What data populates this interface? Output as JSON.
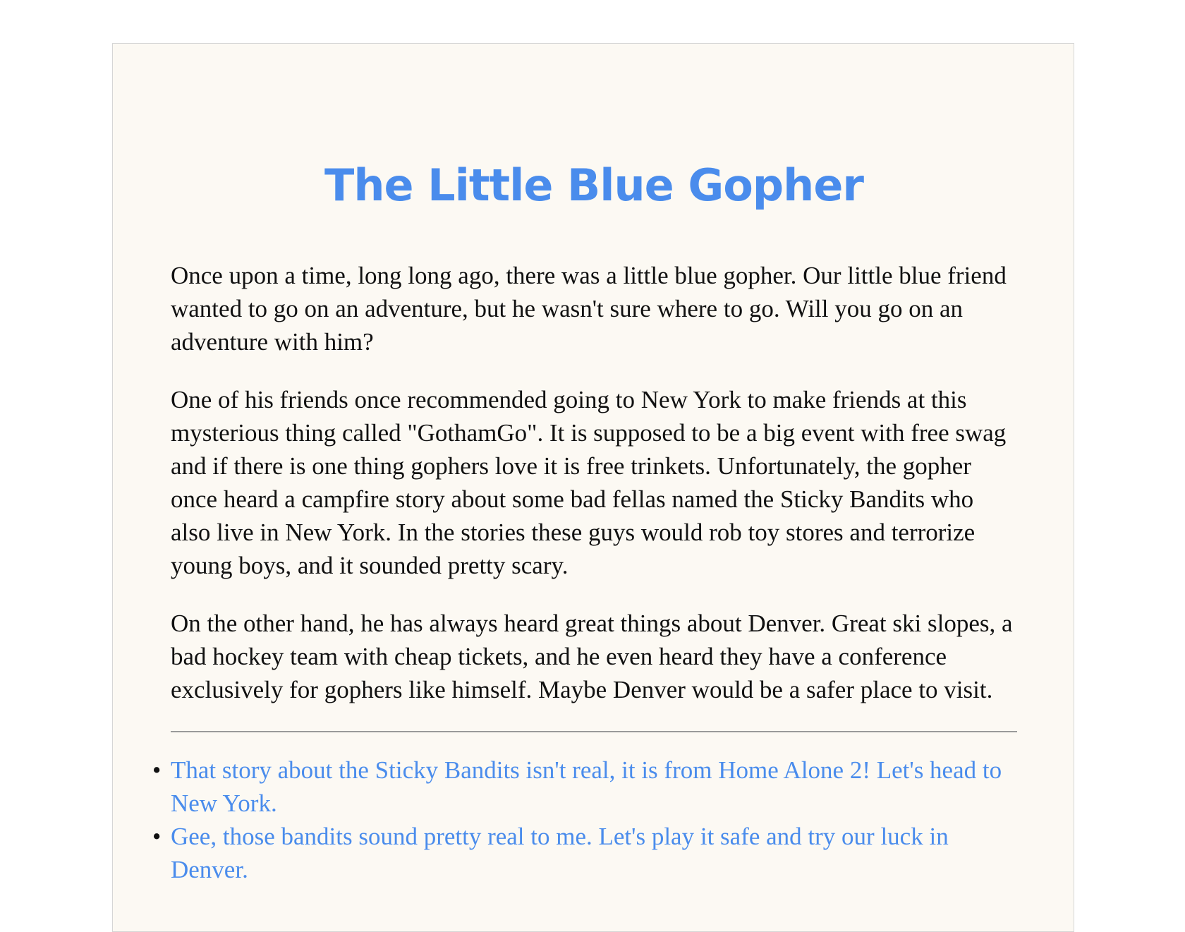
{
  "story": {
    "title": "The Little Blue Gopher",
    "paragraphs": [
      "Once upon a time, long long ago, there was a little blue gopher. Our little blue friend wanted to go on an adventure, but he wasn't sure where to go. Will you go on an adventure with him?",
      "One of his friends once recommended going to New York to make friends at this mysterious thing called \"GothamGo\". It is supposed to be a big event with free swag and if there is one thing gophers love it is free trinkets. Unfortunately, the gopher once heard a campfire story about some bad fellas named the Sticky Bandits who also live in New York. In the stories these guys would rob toy stores and terrorize young boys, and it sounded pretty scary.",
      "On the other hand, he has always heard great things about Denver. Great ski slopes, a bad hockey team with cheap tickets, and he even heard they have a conference exclusively for gophers like himself. Maybe Denver would be a safer place to visit."
    ],
    "options": [
      "That story about the Sticky Bandits isn't real, it is from Home Alone 2! Let's head to New York.",
      "Gee, those bandits sound pretty real to me. Let's play it safe and try our luck in Denver."
    ]
  },
  "colors": {
    "title": "#4a8cec",
    "link": "#4a8cec",
    "page_background": "#fcf9f3"
  }
}
